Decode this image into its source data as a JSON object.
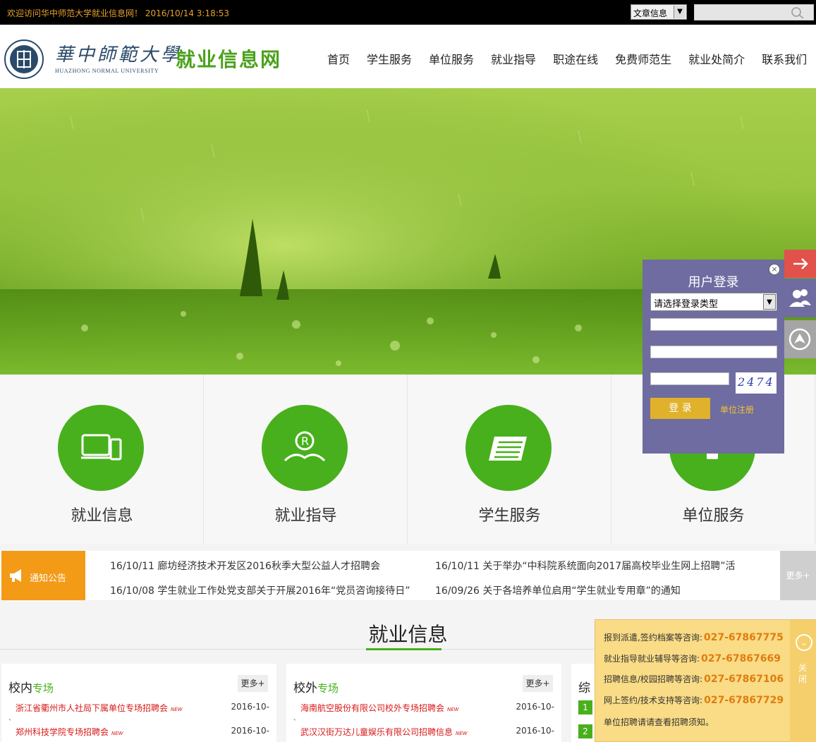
{
  "topbar": {
    "welcome": "欢迎访问华中师范大学就业信息网！ 2016/10/14 3:18:53",
    "search_type": "文章信息"
  },
  "header": {
    "logo_cn": "華中師範大學",
    "logo_en": "HUAZHONG NORMAL UNIVERSITY",
    "site_title": "就业信息网"
  },
  "nav": {
    "items": [
      "首页",
      "学生服务",
      "单位服务",
      "就业指导",
      "职途在线",
      "免费师范生",
      "就业处简介",
      "联系我们"
    ]
  },
  "tiles": [
    {
      "label": "就业信息",
      "icon": "devices-icon"
    },
    {
      "label": "就业指导",
      "icon": "book-icon"
    },
    {
      "label": "学生服务",
      "icon": "document-icon"
    },
    {
      "label": "单位服务",
      "icon": "building-icon"
    }
  ],
  "notice": {
    "tag": "通知公告",
    "more": "更多+",
    "items": [
      "16/10/11 廊坊经济技术开发区2016秋季大型公益人才招聘会",
      "16/10/11 关于举办“中科院系统面向2017届高校毕业生网上招聘”活",
      "16/10/08 学生就业工作处党支部关于开展2016年“党员咨询接待日”",
      "16/09/26 关于各培养单位启用“学生就业专用章”的通知"
    ]
  },
  "section": {
    "title": "就业信息"
  },
  "cards": [
    {
      "title_a": "校内",
      "title_b": "专场",
      "more": "更多+",
      "rows": [
        {
          "text": "浙江省衢州市人社局下属单位专场招聘会",
          "new": "NEW",
          "date": "2016-10-"
        },
        {
          "text": "郑州科技学院专场招聘会",
          "new": "NEW",
          "date": "2016-10-"
        }
      ]
    },
    {
      "title_a": "校外",
      "title_b": "专场",
      "more": "更多+",
      "rows": [
        {
          "text": "海南航空股份有限公司校外专场招聘会",
          "new": "NEW",
          "date": "2016-10-"
        },
        {
          "text": "武汉汉街万达儿童娱乐有限公司招聘信息",
          "new": "NEW",
          "date": "2016-10-"
        }
      ]
    },
    {
      "title_a": "综",
      "numbers": [
        "1",
        "2"
      ]
    }
  ],
  "login": {
    "title": "用户登录",
    "select_placeholder": "请选择登录类型",
    "captcha": "2474",
    "button": "登 录",
    "register": "单位注册"
  },
  "consult": {
    "lines": [
      {
        "label": "报到派遣,签约档案等咨询:",
        "phone": "027-67867775"
      },
      {
        "label": "就业指导就业辅导等咨询:",
        "phone": "027-67867669"
      },
      {
        "label": "招聘信息/校园招聘等咨询:",
        "phone": "027-67867106"
      },
      {
        "label": "网上签约/技术支持等咨询:",
        "phone": "027-67867729"
      }
    ],
    "footer": "单位招聘请请查看招聘须知。",
    "close": "关闭"
  },
  "colors": {
    "brand_green": "#48b01c",
    "notice_orange": "#f39a17",
    "login_purple": "#6e6ca0",
    "consult_yellow": "#f9dc85"
  }
}
